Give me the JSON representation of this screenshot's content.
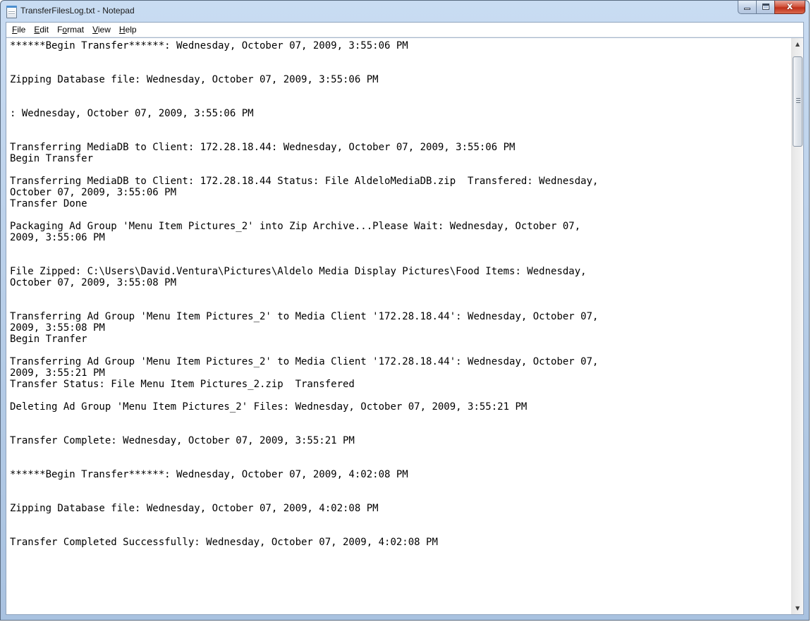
{
  "window": {
    "title": "TransferFilesLog.txt - Notepad",
    "close_glyph": "x"
  },
  "menu": [
    {
      "access": "F",
      "rest": "ile"
    },
    {
      "access": "E",
      "rest": "dit"
    },
    {
      "pre": "F",
      "access": "o",
      "rest": "rmat"
    },
    {
      "access": "V",
      "rest": "iew"
    },
    {
      "access": "H",
      "rest": "elp"
    }
  ],
  "document": {
    "lines": [
      "******Begin Transfer******: Wednesday, October 07, 2009, 3:55:06 PM",
      "",
      "",
      "Zipping Database file: Wednesday, October 07, 2009, 3:55:06 PM",
      "",
      "",
      ": Wednesday, October 07, 2009, 3:55:06 PM",
      "",
      "",
      "Transferring MediaDB to Client: 172.28.18.44: Wednesday, October 07, 2009, 3:55:06 PM",
      "Begin Transfer",
      "",
      "Transferring MediaDB to Client: 172.28.18.44 Status: File AldeloMediaDB.zip  Transfered: Wednesday,",
      "October 07, 2009, 3:55:06 PM",
      "Transfer Done",
      "",
      "Packaging Ad Group 'Menu Item Pictures_2' into Zip Archive...Please Wait: Wednesday, October 07,",
      "2009, 3:55:06 PM",
      "",
      "",
      "File Zipped: C:\\Users\\David.Ventura\\Pictures\\Aldelo Media Display Pictures\\Food Items: Wednesday,",
      "October 07, 2009, 3:55:08 PM",
      "",
      "",
      "Transferring Ad Group 'Menu Item Pictures_2' to Media Client '172.28.18.44': Wednesday, October 07,",
      "2009, 3:55:08 PM",
      "Begin Tranfer",
      "",
      "Transferring Ad Group 'Menu Item Pictures_2' to Media Client '172.28.18.44': Wednesday, October 07,",
      "2009, 3:55:21 PM",
      "Transfer Status: File Menu Item Pictures_2.zip  Transfered",
      "",
      "Deleting Ad Group 'Menu Item Pictures_2' Files: Wednesday, October 07, 2009, 3:55:21 PM",
      "",
      "",
      "Transfer Complete: Wednesday, October 07, 2009, 3:55:21 PM",
      "",
      "",
      "******Begin Transfer******: Wednesday, October 07, 2009, 4:02:08 PM",
      "",
      "",
      "Zipping Database file: Wednesday, October 07, 2009, 4:02:08 PM",
      "",
      "",
      "Transfer Completed Successfully: Wednesday, October 07, 2009, 4:02:08 PM"
    ]
  },
  "colors": {
    "titlebar": "#b9d0ea",
    "close_button": "#c73a22",
    "text": "#000000",
    "background": "#ffffff"
  }
}
